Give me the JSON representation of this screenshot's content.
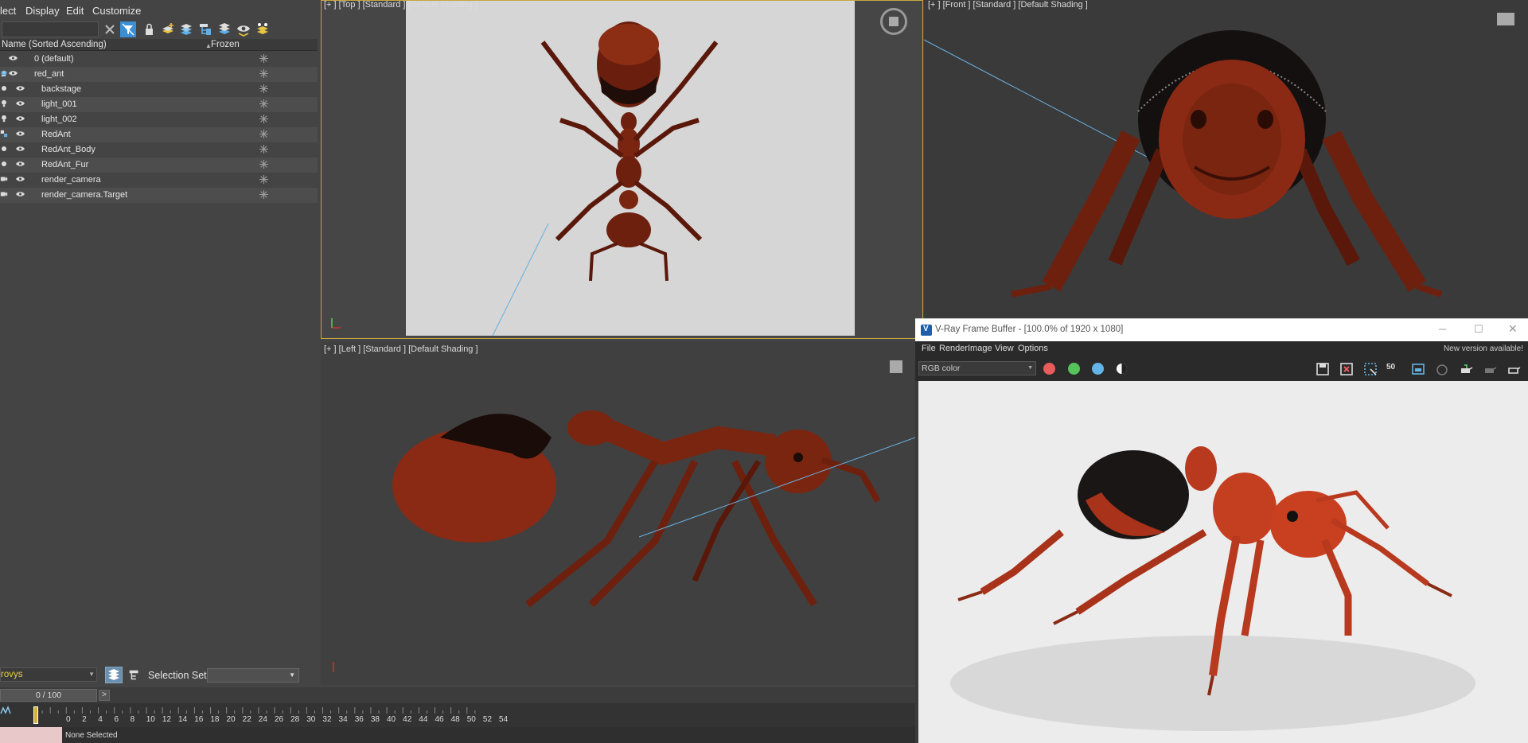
{
  "menubar": {
    "items": [
      "lect",
      "Display",
      "Edit",
      "Customize"
    ]
  },
  "explorer": {
    "col_name": "Name (Sorted Ascending)",
    "col_frozen": "Frozen",
    "rows": [
      {
        "name": "0 (default)",
        "type": "layer"
      },
      {
        "name": "red_ant",
        "type": "layer"
      },
      {
        "name": "backstage",
        "type": "geometry"
      },
      {
        "name": "light_001",
        "type": "light"
      },
      {
        "name": "light_002",
        "type": "light"
      },
      {
        "name": "RedAnt",
        "type": "group"
      },
      {
        "name": "RedAnt_Body",
        "type": "geometry"
      },
      {
        "name": "RedAnt_Fur",
        "type": "geometry"
      },
      {
        "name": "render_camera",
        "type": "camera"
      },
      {
        "name": "render_camera.Target",
        "type": "camera"
      }
    ]
  },
  "workspace": {
    "name": "rovys",
    "selection_set_label": "Selection Set:"
  },
  "viewports": {
    "top": {
      "label": "[+ ] [Top ]  [Standard ]  [Default Shading ]"
    },
    "front": {
      "label": "[+ ] [Front ]  [Standard ]  [Default Shading ]"
    },
    "left": {
      "label": "[+ ] [Left ]  [Standard ]  [Default Shading ]"
    }
  },
  "timeline": {
    "frame_counter": "0 / 100",
    "next_label": ">",
    "ticks": [
      "0",
      "2",
      "4",
      "6",
      "8",
      "10",
      "12",
      "14",
      "16",
      "18",
      "20",
      "22",
      "24",
      "26",
      "28",
      "30",
      "32",
      "34",
      "36",
      "38",
      "40",
      "42",
      "44",
      "46",
      "48",
      "50",
      "52",
      "54"
    ],
    "status": "None Selected"
  },
  "vfb": {
    "title": "V-Ray Frame Buffer - [100.0% of 1920 x 1080]",
    "menu": [
      "File",
      "Render",
      "Image",
      "View",
      "Options"
    ],
    "notice": "New version available!",
    "channel": "RGB color",
    "fifty_label": "50"
  },
  "colors": {
    "ui_bg": "#444444",
    "vfb_dark": "#2a2a2a",
    "accent_blue": "#3b8fd4",
    "channel_red": "#e85c5c",
    "channel_green": "#56c25a",
    "channel_blue": "#63b4e8",
    "ant_red": "#8a2a14"
  }
}
